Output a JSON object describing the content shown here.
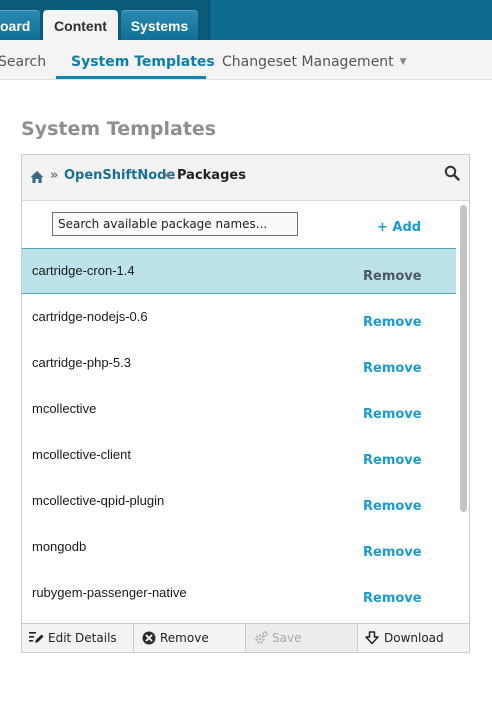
{
  "top_nav": {
    "tabs": [
      {
        "label": "oard"
      },
      {
        "label": "Content"
      },
      {
        "label": "Systems"
      }
    ]
  },
  "sub_nav": {
    "tabs": [
      {
        "label": "Search"
      },
      {
        "label": "System Templates"
      },
      {
        "label": "Changeset Management"
      }
    ],
    "dropdown_icon": "caret-down-icon"
  },
  "page": {
    "title": "System Templates"
  },
  "breadcrumb": {
    "home_icon": "home-icon",
    "separator": "»",
    "items": [
      "OpenShiftNode",
      "Packages"
    ]
  },
  "panel": {
    "search_icon": "search-icon",
    "package_search": {
      "value": "",
      "placeholder": "Search available package names..."
    },
    "add_label": "+ Add",
    "remove_label": "Remove",
    "packages": [
      {
        "name": "cartridge-cron-1.4",
        "selected": true
      },
      {
        "name": "cartridge-nodejs-0.6",
        "selected": false
      },
      {
        "name": "cartridge-php-5.3",
        "selected": false
      },
      {
        "name": "mcollective",
        "selected": false
      },
      {
        "name": "mcollective-client",
        "selected": false
      },
      {
        "name": "mcollective-qpid-plugin",
        "selected": false
      },
      {
        "name": "mongodb",
        "selected": false
      },
      {
        "name": "rubygem-passenger-native",
        "selected": false
      }
    ]
  },
  "toolbar": {
    "edit_label": "Edit Details",
    "remove_label": "Remove",
    "save_label": "Save",
    "download_label": "Download"
  },
  "colors": {
    "nav_blue": "#0e6c91",
    "accent_blue": "#1a9bd1",
    "selected_row": "#bde3ea",
    "title_gray": "#8f8f8f"
  }
}
